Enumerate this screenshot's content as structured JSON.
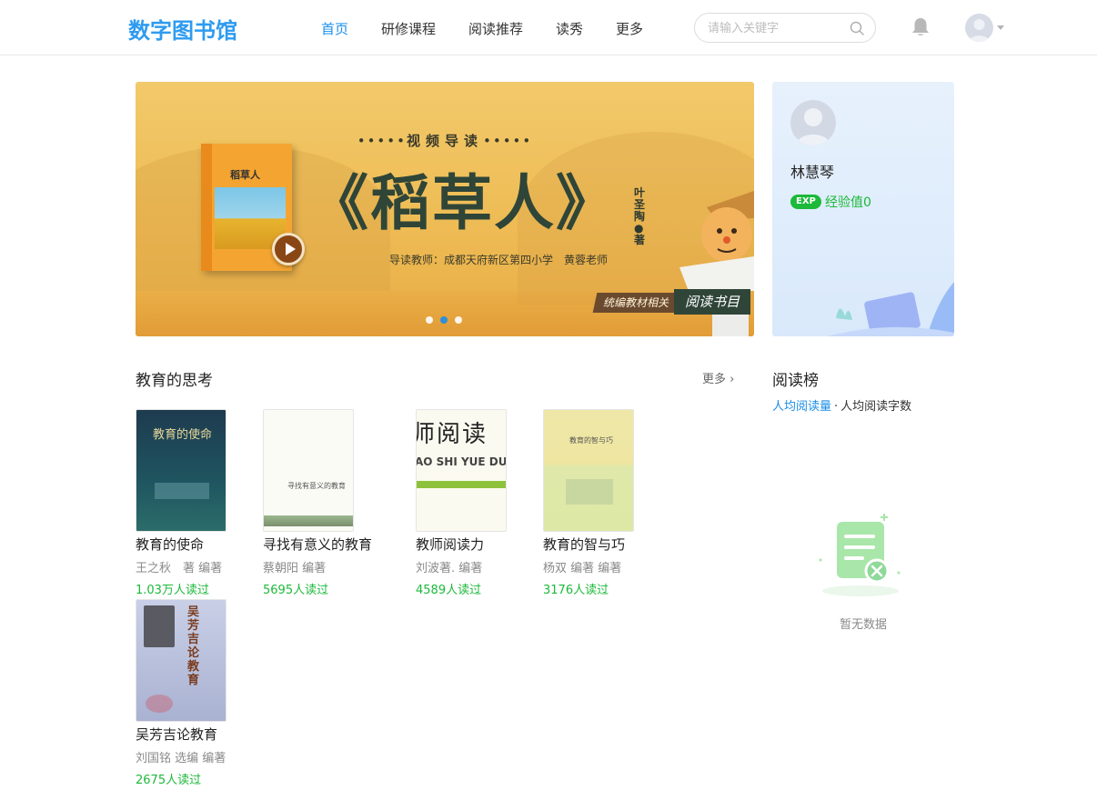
{
  "header": {
    "logo": "数字图书馆",
    "nav": [
      {
        "label": "首页",
        "active": true
      },
      {
        "label": "研修课程",
        "active": false
      },
      {
        "label": "阅读推荐",
        "active": false
      },
      {
        "label": "读秀",
        "active": false
      },
      {
        "label": "更多",
        "active": false
      }
    ],
    "search_placeholder": "请输入关键字"
  },
  "banner": {
    "subtitle": "视频导读",
    "title": "《稻草人》",
    "author": "叶圣陶●著",
    "teacher_line": "导读教师：成都天府新区第四小学　黄蓉老师",
    "book_cover_title": "稻草人",
    "tag_left": "统编教材相关",
    "tag_right": "阅读书目",
    "slide_count": 3,
    "active_slide": 1
  },
  "user": {
    "name": "林慧琴",
    "exp_badge": "EXP",
    "exp_text": "经验值0"
  },
  "section": {
    "title": "教育的思考",
    "more": "更多",
    "books": [
      {
        "title": "教育的使命",
        "author": "王之秋　著 编著",
        "reads": "1.03万人读过",
        "cover_text": "教育的使命"
      },
      {
        "title": "寻找有意义的教育",
        "author": "蔡朝阳 编著",
        "reads": "5695人读过",
        "cover_text": "寻找有意义的教育"
      },
      {
        "title": "教师阅读力",
        "author": "刘波著. 编著",
        "reads": "4589人读过",
        "cover_text": "师阅读",
        "cover_sub": "AO SHI YUE DU"
      },
      {
        "title": "教育的智与巧",
        "author": "杨双 编著 编著",
        "reads": "3176人读过",
        "cover_text": "教育的智与巧"
      },
      {
        "title": "吴芳吉论教育",
        "author": "刘国铭 选编 编著",
        "reads": "2675人读过",
        "cover_text": "吴芳吉论教育"
      }
    ]
  },
  "ranking": {
    "title": "阅读榜",
    "tabs": [
      {
        "label": "人均阅读量",
        "active": true
      },
      {
        "label": "人均阅读字数",
        "active": false
      }
    ],
    "separator": "·",
    "empty_text": "暂无数据"
  },
  "colors": {
    "brand": "#2e9bf0",
    "nav_active": "#1a8ee8",
    "green": "#1cb93a"
  }
}
